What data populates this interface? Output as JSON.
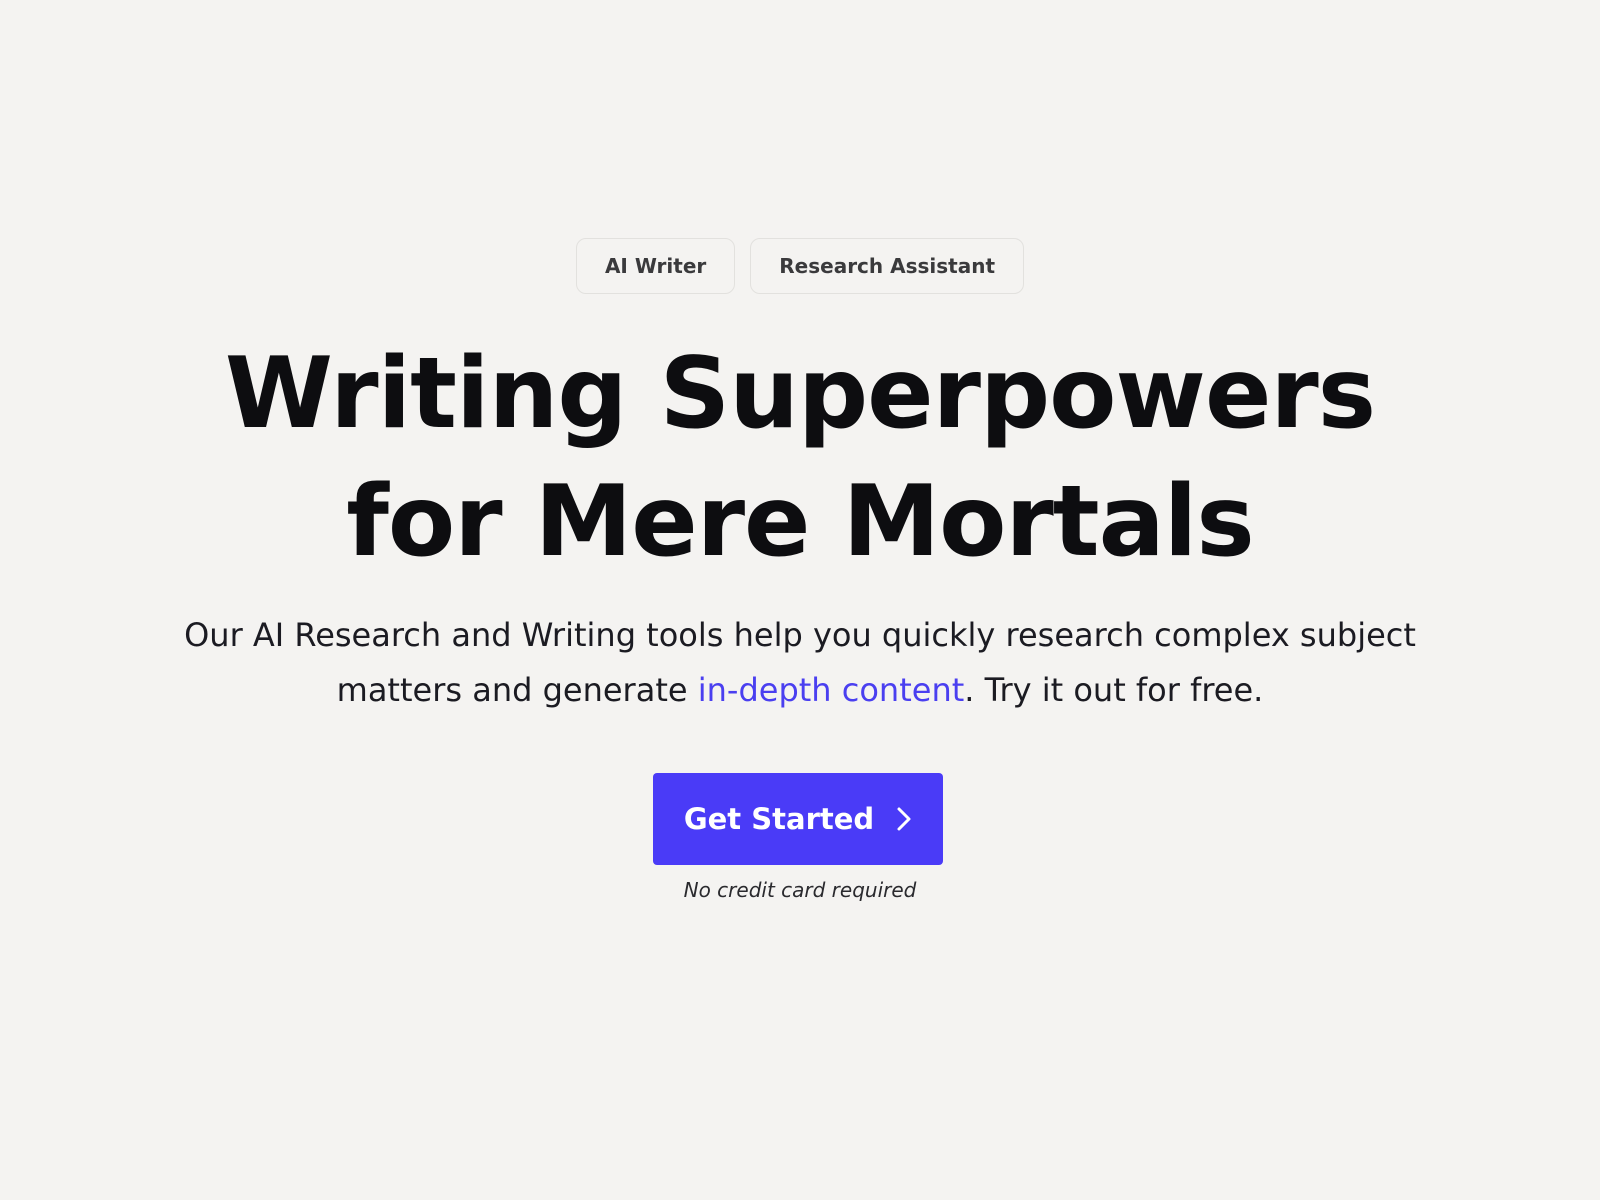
{
  "tags": [
    {
      "label": "AI Writer"
    },
    {
      "label": "Research Assistant"
    }
  ],
  "headline": {
    "line1": "Writing Superpowers",
    "line2": "for Mere Mortals"
  },
  "subtitle": {
    "before": "Our AI Research and Writing tools help you quickly research complex subject matters and generate ",
    "highlight": "in-depth content",
    "after": ". Try it out for free."
  },
  "cta": {
    "label": "Get Started",
    "icon": "chevron-right-icon"
  },
  "note": "No credit card required",
  "colors": {
    "background": "#f4f3f1",
    "accent": "#4a3bf7",
    "highlight_text": "#4a3ff0",
    "headline": "#0d0d10"
  }
}
